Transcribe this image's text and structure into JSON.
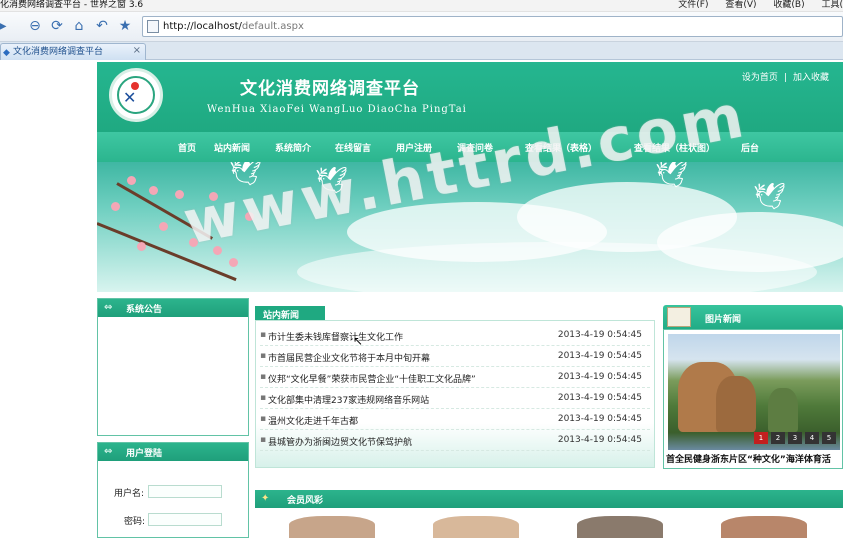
{
  "window": {
    "title": "化消费网络调查平台 - 世界之窗 3.6",
    "menus": [
      "文件(F)",
      "查看(V)",
      "收藏(B)",
      "工具("
    ]
  },
  "browser": {
    "url_host": "http://localhost/",
    "url_path": "default.aspx",
    "tab_title": "文化消费网络调查平台"
  },
  "header": {
    "title": "文化消费网络调查平台",
    "subtitle": "WenHua XiaoFei WangLuo DiaoCha PingTai",
    "links": [
      "设为首页",
      "加入收藏"
    ],
    "separator": "|"
  },
  "nav": {
    "items": [
      "首页",
      "站内新闻",
      "系统简介",
      "在线留言",
      "用户注册",
      "调查问卷",
      "查看结果（表格）",
      "查看结果（柱状图）",
      "后台"
    ]
  },
  "notice": {
    "title": "系统公告"
  },
  "login": {
    "title": "用户登陆",
    "username_label": "用户名:",
    "password_label": "密码:"
  },
  "news": {
    "title": "站内新闻",
    "items": [
      {
        "title": "市计生委未钱库督察计生文化工作",
        "date": "2013-4-19 0:54:45"
      },
      {
        "title": "市首届民营企业文化节将于本月中旬开幕",
        "date": "2013-4-19 0:54:45"
      },
      {
        "title": "仪邦“文化早餐”荣获市民营企业“十佳职工文化品牌”",
        "date": "2013-4-19 0:54:45"
      },
      {
        "title": "文化部集中清理237家违规网络音乐网站",
        "date": "2013-4-19 0:54:45"
      },
      {
        "title": "温州文化走进千年古都",
        "date": "2013-4-19 0:54:45"
      },
      {
        "title": "县城管办为浙闽边贸文化节保驾护航",
        "date": "2013-4-19 0:54:45"
      }
    ]
  },
  "picture_news": {
    "title": "图片新闻",
    "pages": [
      "1",
      "2",
      "3",
      "4",
      "5"
    ],
    "caption": "首全民健身浙东片区“种文化”海洋体育活"
  },
  "members": {
    "title": "会员风彩"
  },
  "watermark": "www.httrd.com",
  "colors": {
    "brand_green": "#1fa981",
    "nav_green": "#2bb58e",
    "border_green": "#62c3a6"
  }
}
